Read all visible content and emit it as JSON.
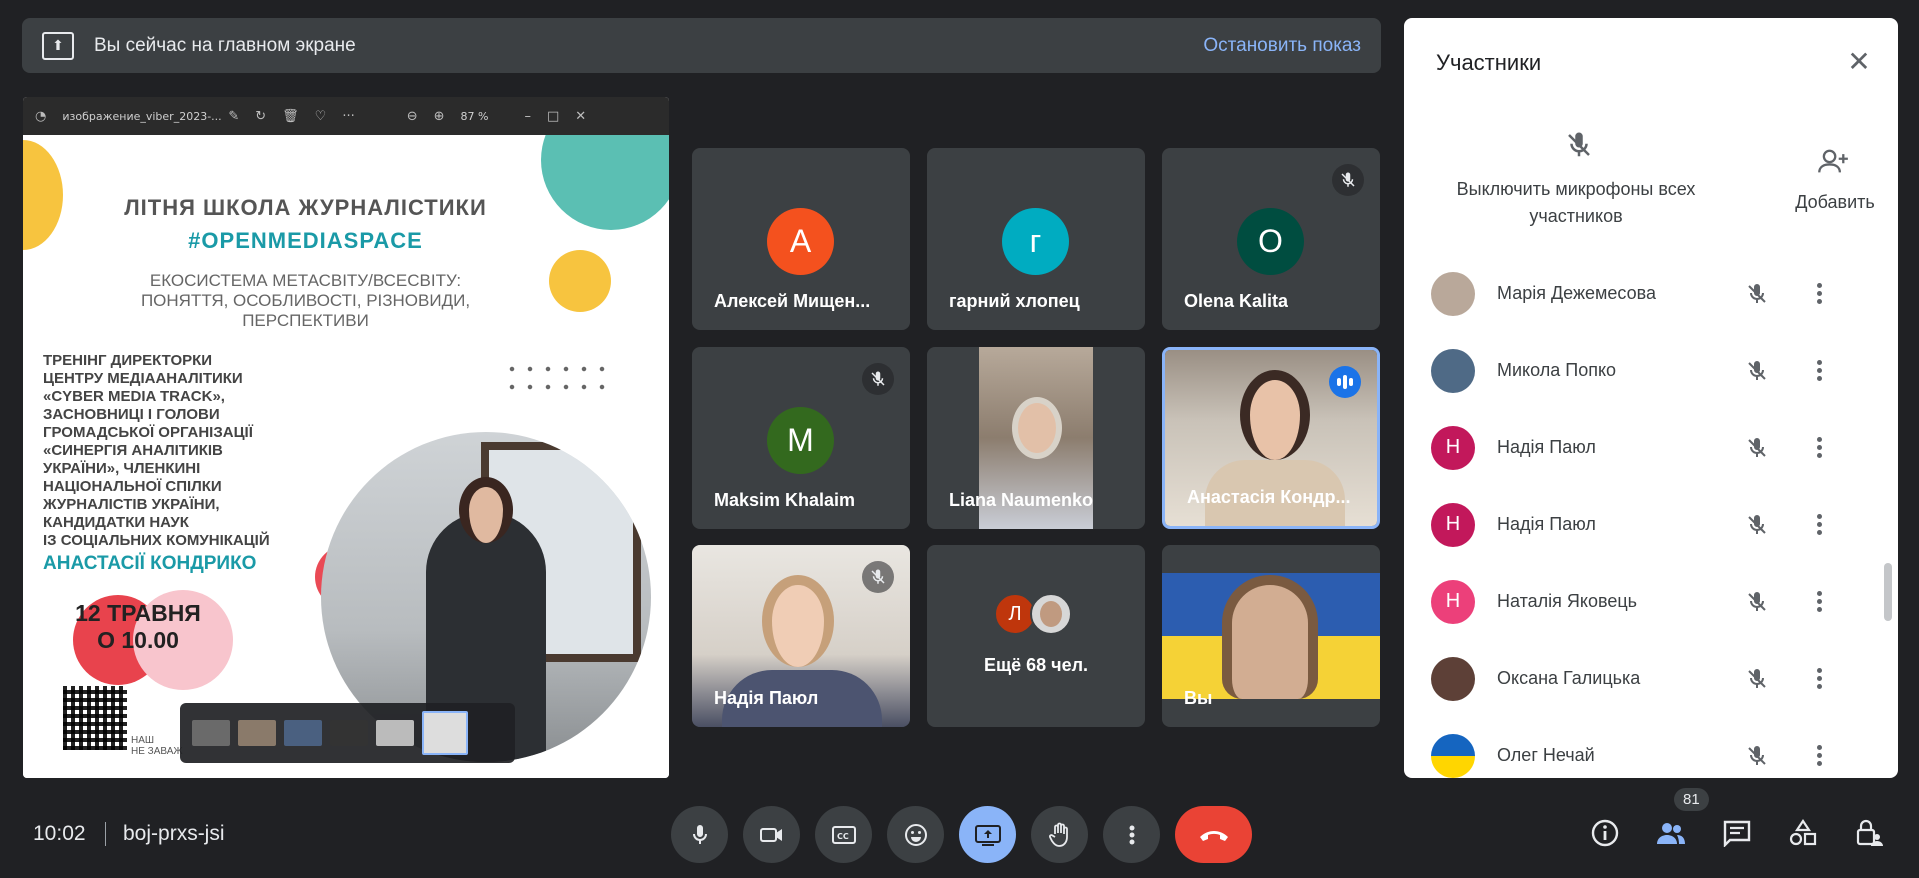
{
  "banner": {
    "text": "Вы сейчас на главном экране",
    "stop_label": "Остановить показ"
  },
  "viewer": {
    "filename": "изображение_viber_2023-...",
    "zoom": "87 %"
  },
  "poster": {
    "title1": "ЛІТНЯ ШКОЛА ЖУРНАЛІСТИКИ",
    "title2": "#OPENMEDIASPACE",
    "subtitle1": "ЕКОСИСТЕМА МЕТАСВІТУ/ВСЕСВІТУ:",
    "subtitle2": "ПОНЯТТЯ, ОСОБЛИВОСТІ, РІЗНОВИДИ,",
    "subtitle3": "ПЕРСПЕКТИВИ",
    "body": [
      "ТРЕНІНГ ДИРЕКТОРКИ",
      "ЦЕНТРУ МЕДІААНАЛІТИКИ",
      "«CYBER MEDIA TRACK»,",
      "ЗАСНОВНИЦІ І ГОЛОВИ",
      "ГРОМАДСЬКОЇ ОРГАНІЗАЦІЇ",
      " «СИНЕРГІЯ АНАЛІТИКІВ",
      "УКРАЇНИ», ЧЛЕНКИНІ",
      "НАЦІОНАЛЬНОЇ СПІЛКИ",
      "ЖУРНАЛІСТІВ УКРАЇНИ,",
      "КАНДИДАТКИ НАУК",
      "ІЗ СОЦІАЛЬНИХ КОМУНІКАЦІЙ"
    ],
    "name": "АНАСТАСІЇ КОНДРИКО",
    "date1": "12 ТРАВНЯ",
    "date2": "О 10.00",
    "foot1": "НАШ",
    "foot2": "НЕ ЗАВАЖ"
  },
  "tiles": [
    {
      "name": "Алексей Мищен...",
      "initial": "А",
      "color": "#f4511e",
      "muted": false
    },
    {
      "name": "гарний хлопец",
      "initial": "г",
      "color": "#00acc1",
      "muted": false
    },
    {
      "name": "Olena Kalita",
      "initial": "O",
      "color": "#004d40",
      "muted": true
    },
    {
      "name": "Maksim Khalaim",
      "initial": "M",
      "color": "#33691e",
      "muted": true
    },
    {
      "name": "Liana Naumenko"
    },
    {
      "name": "Анастасія Кондр..."
    },
    {
      "name": "Надія Паюл"
    },
    {
      "more_label": "Ещё 68 чел.",
      "initial": "Л"
    },
    {
      "name": "Вы"
    }
  ],
  "panel": {
    "title": "Участники",
    "mute_all": "Выключить микрофоны всех участников",
    "add_label": "Добавить",
    "participants": [
      {
        "name": "Марія Дежемесова",
        "initial": "",
        "color": "#b9a89a"
      },
      {
        "name": "Микола Попко",
        "initial": "",
        "color": "#4f6a86"
      },
      {
        "name": "Надія Паюл",
        "initial": "Н",
        "color": "#c2185b"
      },
      {
        "name": "Надія Паюл",
        "initial": "Н",
        "color": "#c2185b"
      },
      {
        "name": "Наталія Яковець",
        "initial": "Н",
        "color": "#ec407a"
      },
      {
        "name": "Оксана Галицька",
        "initial": "",
        "color": "#5d4037"
      },
      {
        "name": "Олег Нечай",
        "initial": "",
        "color": "#ffd600"
      }
    ]
  },
  "bottom": {
    "time": "10:02",
    "code": "boj-prxs-jsi",
    "participants_count": "81"
  },
  "colors": {
    "background": "#202124",
    "tile": "#3c4043",
    "accent": "#8ab4f8",
    "end_call": "#ea4335"
  }
}
